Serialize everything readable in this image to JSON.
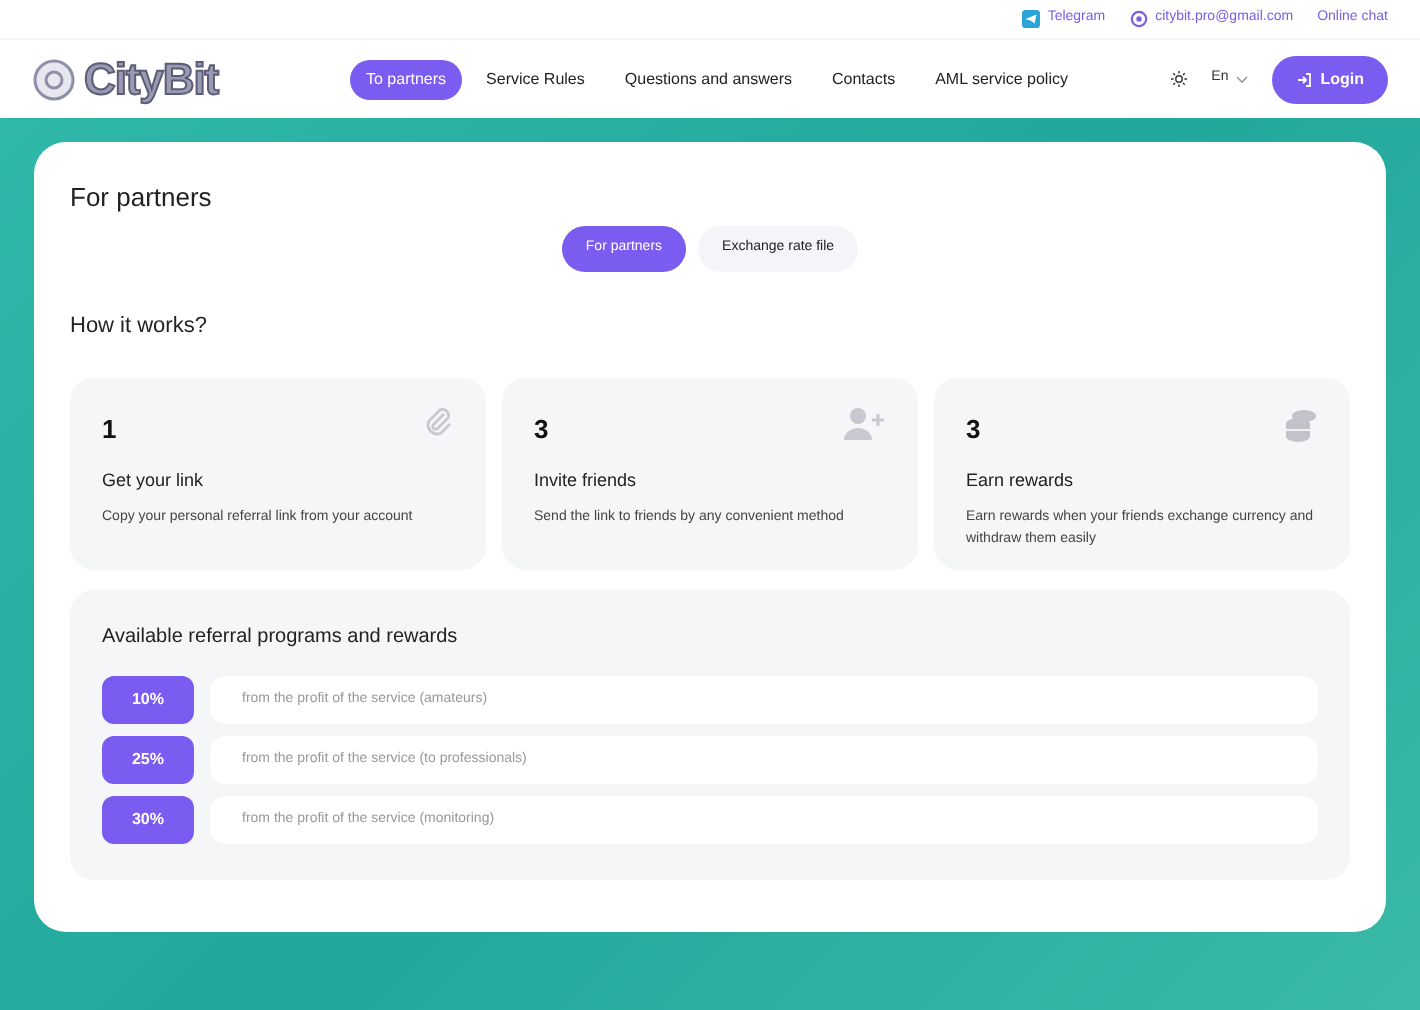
{
  "top_bar": {
    "links": [
      {
        "kind": "telegram",
        "label": "Telegram"
      },
      {
        "kind": "email",
        "label": "citybit.pro@gmail.com"
      },
      {
        "kind": "chat",
        "label": "Online chat"
      }
    ]
  },
  "header": {
    "logo": "CityBit",
    "nav": [
      {
        "label": "To partners",
        "selected": true
      },
      {
        "label": "Service Rules",
        "selected": false
      },
      {
        "label": "Questions and answers",
        "selected": false
      },
      {
        "label": "Contacts",
        "selected": false
      },
      {
        "label": "AML service policy",
        "selected": false
      }
    ],
    "language": "En",
    "login": "Login"
  },
  "page": {
    "title": "For partners",
    "tabs": [
      {
        "label": "For partners",
        "selected": true
      },
      {
        "label": "Exchange rate file",
        "selected": false
      }
    ],
    "section_title": "How it works?",
    "steps": [
      {
        "kind": "link",
        "number": "1",
        "title": "Get your link",
        "text": "Copy your personal referral link from your account"
      },
      {
        "kind": "invite",
        "number": "3",
        "title": "Invite friends",
        "text": "Send the link to friends by any convenient method"
      },
      {
        "kind": "coins",
        "number": "3",
        "title": "Earn rewards",
        "text": "Earn rewards when your friends exchange currency and withdraw them easily"
      }
    ],
    "programs": {
      "title": "Available referral programs and rewards",
      "rows": [
        {
          "percent": "10%",
          "text": "from the profit of the service (amateurs)"
        },
        {
          "percent": "25%",
          "text": "from the profit of the service (to professionals)"
        },
        {
          "percent": "30%",
          "text": "from the profit of the service (monitoring)"
        }
      ]
    }
  }
}
